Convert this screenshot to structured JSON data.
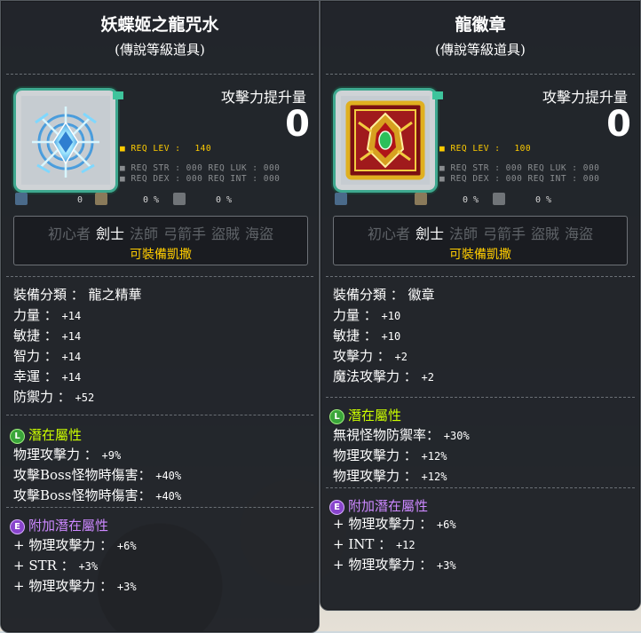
{
  "left": {
    "name": "妖蝶姬之龍咒水",
    "grade": "(傳說等級道具)",
    "attack_increase_label": "攻擊力提升量",
    "attack_increase_value": "0",
    "req_lev_label": "REQ LEV :",
    "req_lev_value": "140",
    "req_line1": "REQ STR : 000 REQ LUK : 000",
    "req_line2": "REQ DEX : 000 REQ INT : 000",
    "small_row": [
      "0",
      "0 %",
      "0 %"
    ],
    "jobs": [
      "初心者",
      "劍士",
      "法師",
      "弓箭手",
      "盜賊",
      "海盜"
    ],
    "active_jobs": [
      "劍士"
    ],
    "equip_note": "可裝備凱撒",
    "stats": [
      {
        "label": "裝備分類 ： 龍之精華",
        "num": ""
      },
      {
        "label": "力量 ： ",
        "num": "+14"
      },
      {
        "label": "敏捷 ： ",
        "num": "+14"
      },
      {
        "label": "智力 ： ",
        "num": "+14"
      },
      {
        "label": "幸運 ： ",
        "num": "+14"
      },
      {
        "label": "防禦力 ： ",
        "num": "+52"
      }
    ],
    "potential_title": "潛在屬性",
    "potential_badge": "L",
    "potential_lines": [
      {
        "label": "物理攻擊力 ： ",
        "num": "+9%"
      },
      {
        "label": "攻擊Boss怪物時傷害： ",
        "num": "+40%"
      },
      {
        "label": "攻擊Boss怪物時傷害： ",
        "num": "+40%"
      }
    ],
    "additional_title": "附加潛在屬性",
    "additional_badge": "E",
    "additional_lines": [
      {
        "label": "+ 物理攻擊力 ： ",
        "num": "+6%"
      },
      {
        "label": "+ STR ： ",
        "num": "+3%"
      },
      {
        "label": "+ 物理攻擊力 ： ",
        "num": "+3%"
      }
    ]
  },
  "right": {
    "name": "龍徽章",
    "grade": "(傳說等級道具)",
    "attack_increase_label": "攻擊力提升量",
    "attack_increase_value": "0",
    "req_lev_label": "REQ LEV :",
    "req_lev_value": "100",
    "req_line1": "REQ STR : 000 REQ LUK : 000",
    "req_line2": "REQ DEX : 000 REQ INT : 000",
    "small_row": [
      "0 %",
      "0 %"
    ],
    "jobs": [
      "初心者",
      "劍士",
      "法師",
      "弓箭手",
      "盜賊",
      "海盜"
    ],
    "active_jobs": [
      "劍士"
    ],
    "equip_note": "可裝備凱撒",
    "stats": [
      {
        "label": "裝備分類 ： 徽章",
        "num": ""
      },
      {
        "label": "力量 ： ",
        "num": "+10"
      },
      {
        "label": "敏捷 ： ",
        "num": "+10"
      },
      {
        "label": "攻擊力 ： ",
        "num": "+2"
      },
      {
        "label": "魔法攻擊力 ： ",
        "num": "+2"
      }
    ],
    "potential_title": "潛在屬性",
    "potential_badge": "L",
    "potential_lines": [
      {
        "label": "無視怪物防禦率： ",
        "num": "+30%"
      },
      {
        "label": "物理攻擊力 ： ",
        "num": "+12%"
      },
      {
        "label": "物理攻擊力 ： ",
        "num": "+12%"
      }
    ],
    "additional_title": "附加潛在屬性",
    "additional_badge": "E",
    "additional_lines": [
      {
        "label": "+ 物理攻擊力 ： ",
        "num": "+6%"
      },
      {
        "label": "+ INT ： ",
        "num": "+12"
      },
      {
        "label": "+ 物理攻擊力 ： ",
        "num": "+3%"
      }
    ]
  },
  "colors": {
    "legendary": "#ccff00",
    "additional": "#cc88ff",
    "req_level": "#ffcc00",
    "equip_note": "#ffcc00",
    "tooltip_bg": "#1e2126"
  },
  "icons": {
    "left_item": "dragon-essence-ice-crest-icon",
    "right_item": "dragon-emblem-icon",
    "small_row": [
      "wrench-icon",
      "upgrade-slot-icon",
      "shield-icon"
    ]
  }
}
